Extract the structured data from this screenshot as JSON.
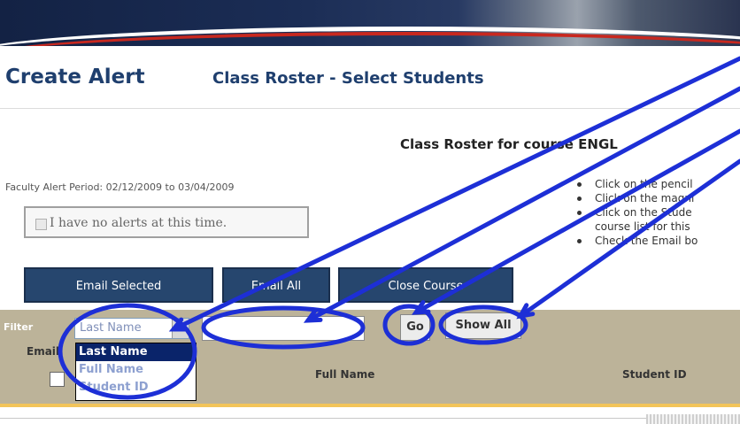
{
  "page": {
    "title": "Create Alert",
    "subtitle": "Class Roster - Select Students",
    "roster_heading": "Class Roster for course ENGL"
  },
  "alert_period": {
    "label": "Faculty Alert Period:",
    "value": "02/12/2009 to 03/04/2009"
  },
  "no_alerts_label": "I have no alerts at this time.",
  "instructions": [
    "Click on the pencil",
    "Click on the magni",
    "Click on the Stude",
    "course list for this",
    "Check the Email bo"
  ],
  "buttons": {
    "email_selected": "Email Selected",
    "email_all": "Email All",
    "close_course": "Close Course",
    "go": "Go",
    "show_all": "Show All"
  },
  "filter": {
    "label": "Filter",
    "selected": "Last Name",
    "options": [
      "Last Name",
      "Full Name",
      "Student ID"
    ],
    "search_value": ""
  },
  "table": {
    "columns": [
      "Email",
      "Full Name",
      "Student ID"
    ]
  },
  "annotation_color": "#1d2fd6"
}
